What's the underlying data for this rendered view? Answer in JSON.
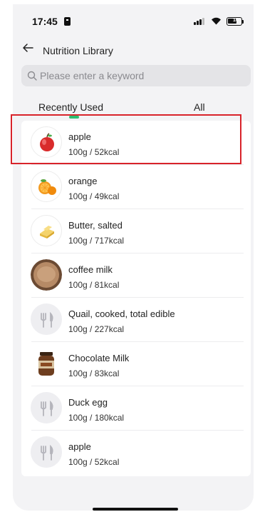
{
  "status_bar": {
    "time": "17:45",
    "battery": "10"
  },
  "header": {
    "title": "Nutrition Library",
    "back_icon": "arrow-left-icon"
  },
  "search": {
    "placeholder": "Please enter a keyword",
    "value": ""
  },
  "tabs": [
    {
      "label": "Recently Used",
      "selected": true
    },
    {
      "label": "All",
      "selected": false
    }
  ],
  "colors": {
    "accent": "#2fbf71",
    "highlight": "#d8232a",
    "background": "#f3f3f5"
  },
  "items": [
    {
      "name": "apple",
      "desc": "100g / 52kcal",
      "icon": "apple-icon",
      "highlighted": true
    },
    {
      "name": "orange",
      "desc": "100g / 49kcal",
      "icon": "orange-icon"
    },
    {
      "name": "Butter, salted",
      "desc": "100g / 717kcal",
      "icon": "butter-icon"
    },
    {
      "name": "coffee milk",
      "desc": "100g / 81kcal",
      "icon": "coffee-milk-icon"
    },
    {
      "name": "Quail, cooked, total edible",
      "desc": "100g / 227kcal",
      "icon": "cutlery-icon"
    },
    {
      "name": "Chocolate Milk",
      "desc": "100g / 83kcal",
      "icon": "chocolate-milk-icon"
    },
    {
      "name": "Duck egg",
      "desc": "100g / 180kcal",
      "icon": "cutlery-icon"
    },
    {
      "name": "apple",
      "desc": "100g / 52kcal",
      "icon": "cutlery-icon"
    }
  ]
}
